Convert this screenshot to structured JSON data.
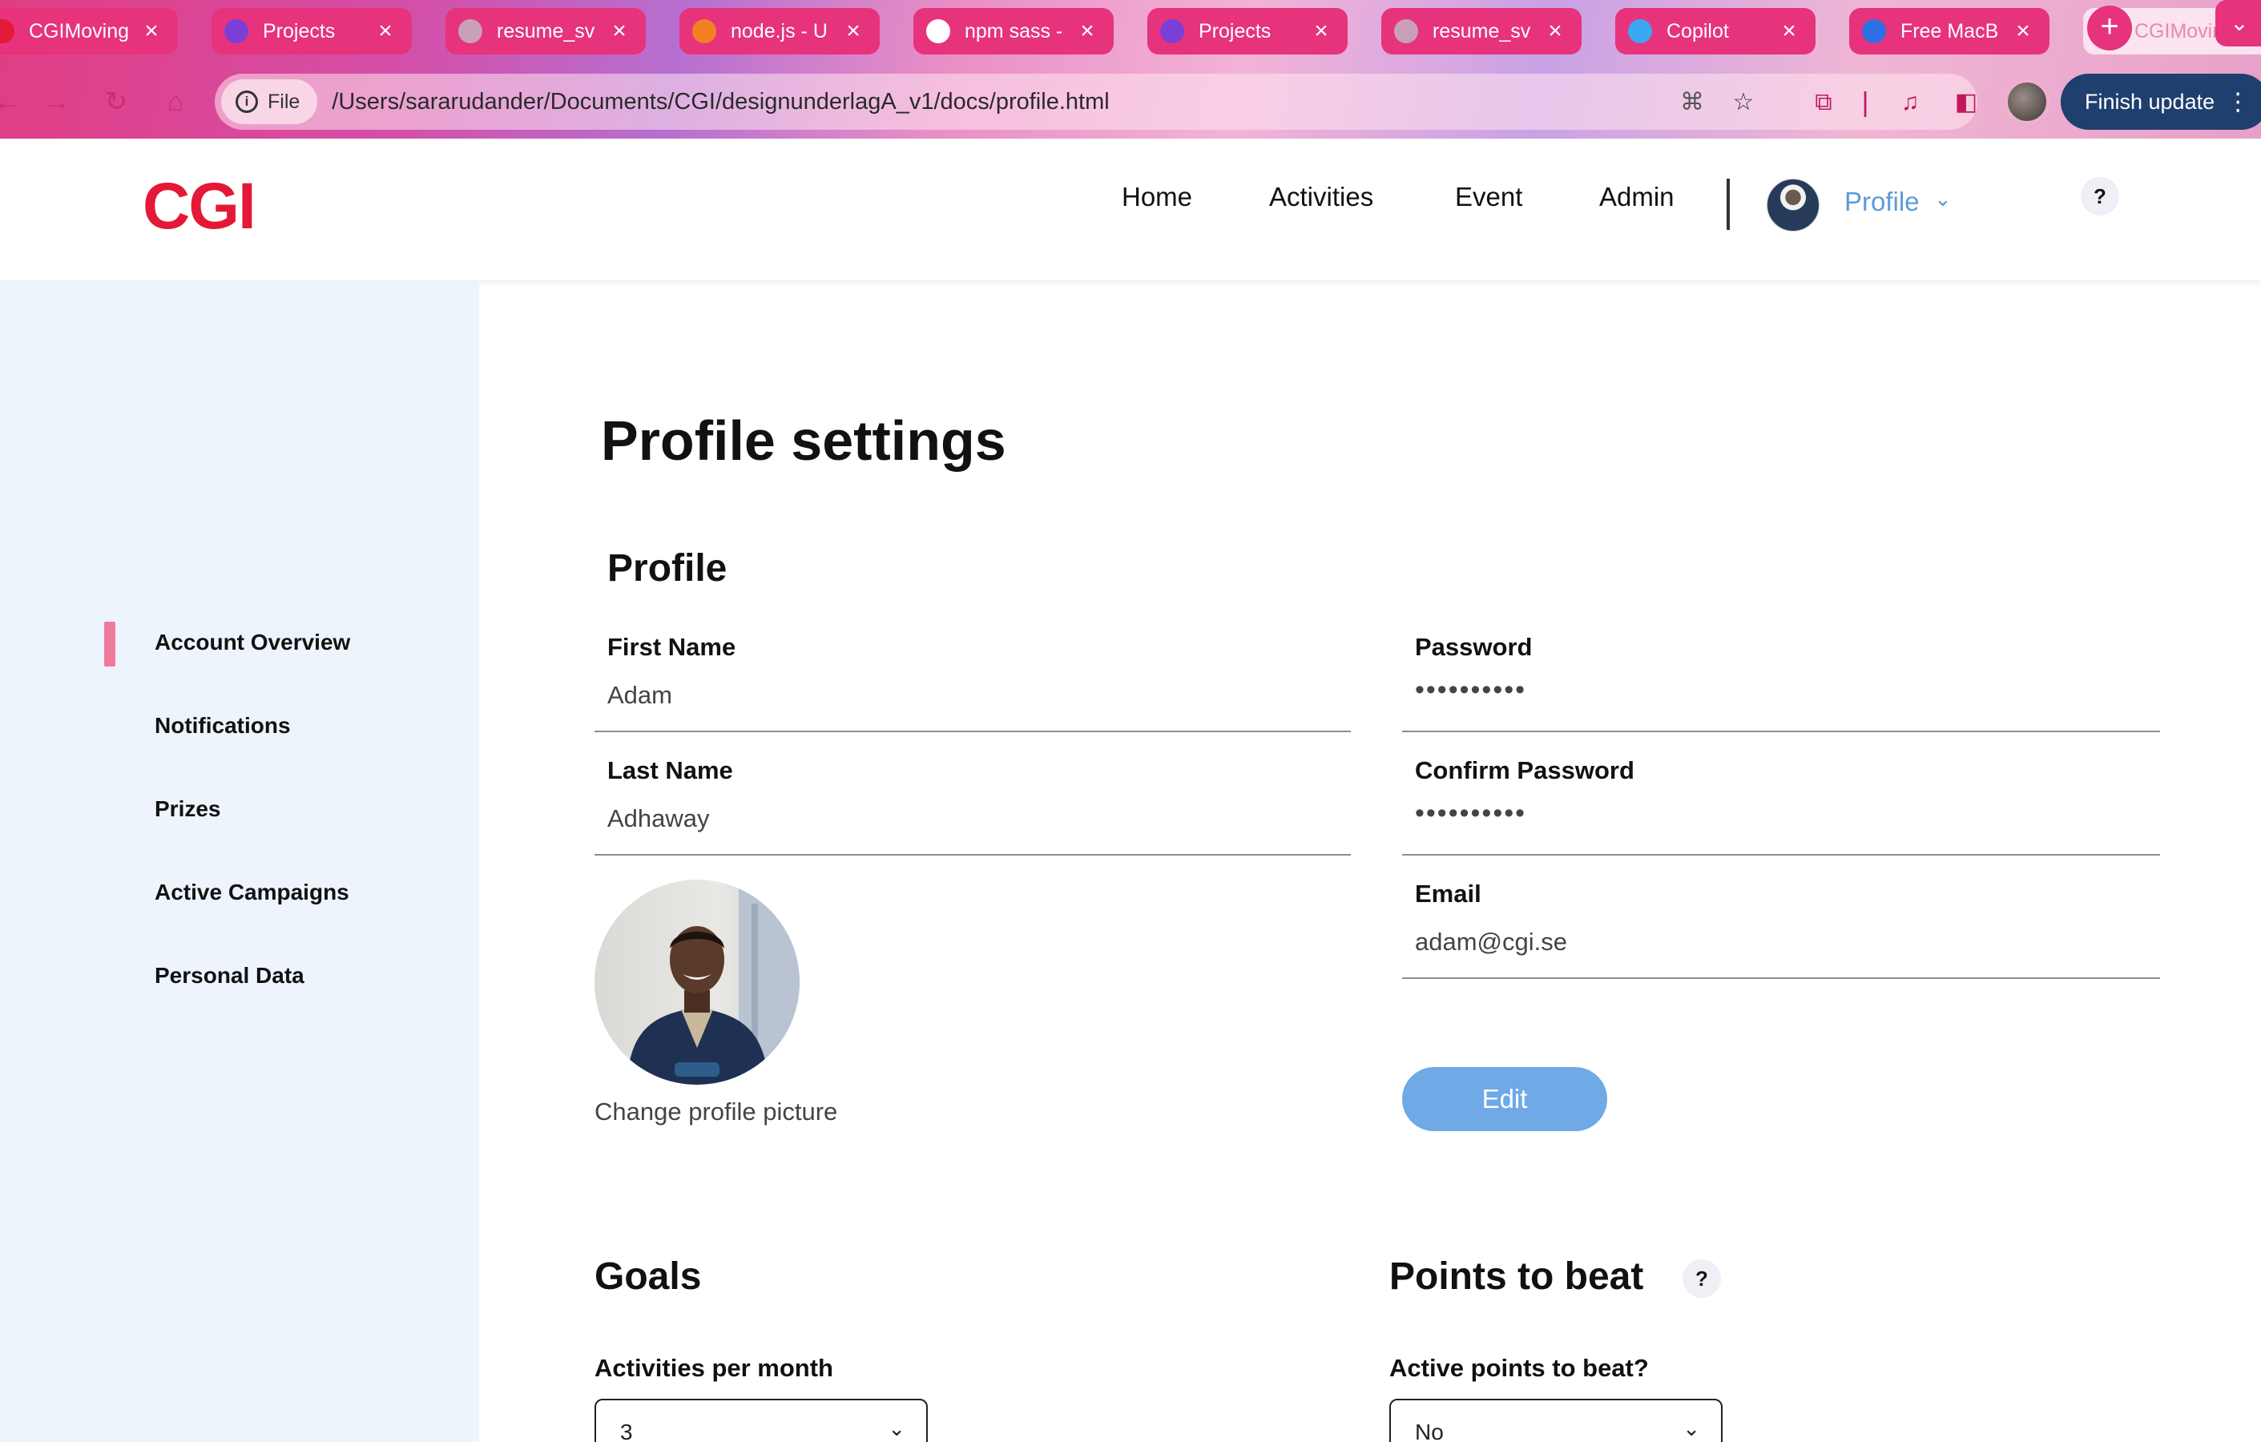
{
  "browser": {
    "tabs": [
      {
        "label": "CGIMoving",
        "favicon": "cgi-favicon"
      },
      {
        "label": "Projects",
        "favicon": "firefox-favicon"
      },
      {
        "label": "resume_sv",
        "favicon": "globe-favicon"
      },
      {
        "label": "node.js - U",
        "favicon": "stackoverflow-favicon"
      },
      {
        "label": "npm sass -",
        "favicon": "google-favicon"
      },
      {
        "label": "Projects",
        "favicon": "firefox-favicon"
      },
      {
        "label": "resume_sv",
        "favicon": "globe-favicon"
      },
      {
        "label": "Copilot",
        "favicon": "copilot-favicon"
      },
      {
        "label": "Free MacB",
        "favicon": "malwarebytes-favicon"
      },
      {
        "label": "CGIMoving",
        "favicon": "cgi-favicon",
        "active": true
      }
    ],
    "file_chip": "File",
    "url": "/Users/sararudander/Documents/CGI/designunderlagA_v1/docs/profile.html",
    "update_button": "Finish update"
  },
  "header": {
    "logo": "CGI",
    "nav": [
      "Home",
      "Activities",
      "Event",
      "Admin"
    ],
    "profile_label": "Profile",
    "help": "?"
  },
  "sidebar": {
    "items": [
      "Account Overview",
      "Notifications",
      "Prizes",
      "Active Campaigns",
      "Personal Data"
    ],
    "active_index": 0
  },
  "main": {
    "title": "Profile settings",
    "profile_section": "Profile",
    "fields": {
      "first_name": {
        "label": "First Name",
        "value": "Adam"
      },
      "last_name": {
        "label": "Last Name",
        "value": "Adhaway"
      },
      "password": {
        "label": "Password",
        "value": "••••••••••"
      },
      "confirm_password": {
        "label": "Confirm Password",
        "value": "••••••••••"
      },
      "email": {
        "label": "Email",
        "value": "adam@cgi.se"
      }
    },
    "change_picture": "Change profile picture",
    "edit_button": "Edit",
    "goals": {
      "title": "Goals",
      "label": "Activities per month",
      "value": "3"
    },
    "points": {
      "title": "Points to beat",
      "help": "?",
      "label": "Active points to beat?",
      "value": "No"
    }
  },
  "colors": {
    "accent_pink": "#e6337c",
    "logo_red": "#e31937",
    "link_blue": "#5b9bd6",
    "button_blue": "#6fa9e6",
    "sidebar_bg": "#edf4fc",
    "active_marker": "#f07a9c"
  }
}
